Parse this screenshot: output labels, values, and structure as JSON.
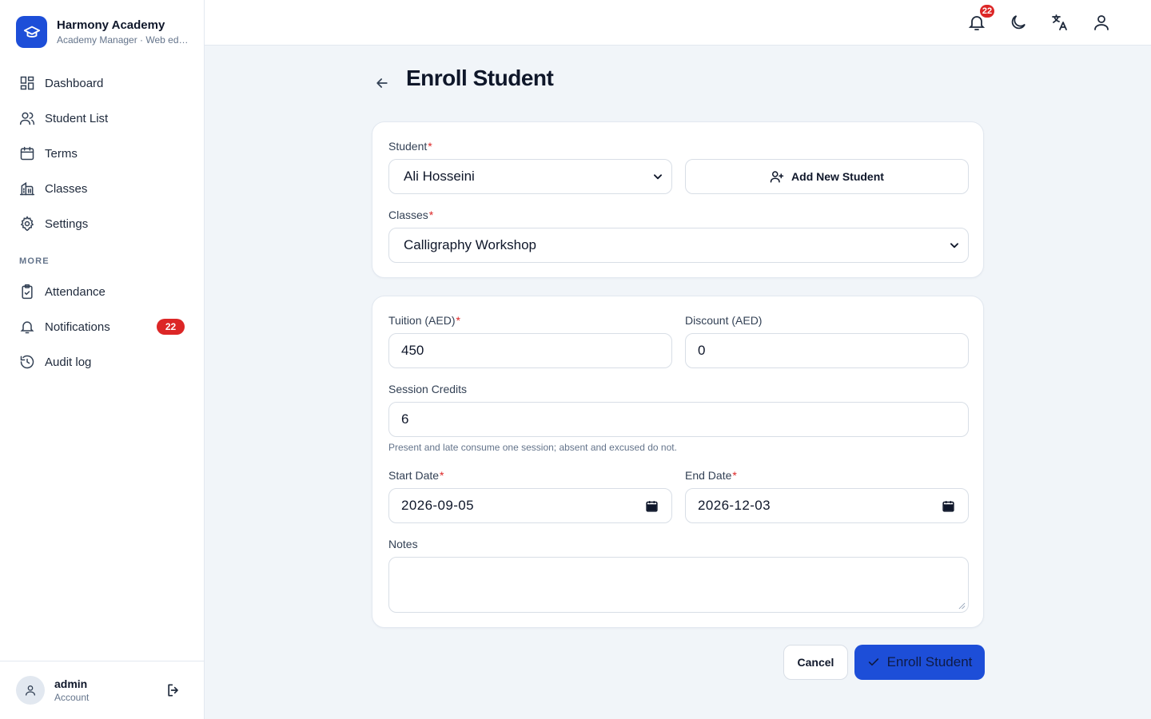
{
  "brand": {
    "name": "Harmony Academy",
    "subtitle": "Academy Manager · Web edition"
  },
  "sidebar": {
    "items": [
      {
        "label": "Dashboard",
        "icon": "dashboard-icon"
      },
      {
        "label": "Student List",
        "icon": "users-icon"
      },
      {
        "label": "Terms",
        "icon": "calendar-icon"
      },
      {
        "label": "Classes",
        "icon": "building-icon"
      },
      {
        "label": "Settings",
        "icon": "gear-icon"
      }
    ],
    "section_label": "MORE",
    "more_items": [
      {
        "label": "Attendance",
        "icon": "clipboard-icon"
      },
      {
        "label": "Notifications",
        "icon": "bell-icon",
        "badge": "22"
      },
      {
        "label": "Audit log",
        "icon": "history-icon"
      }
    ]
  },
  "account": {
    "name": "admin",
    "role": "Account"
  },
  "topbar": {
    "notification_count": "22",
    "icons": [
      "bell-icon",
      "moon-icon",
      "translate-icon",
      "user-icon"
    ]
  },
  "page": {
    "title": "Enroll Student"
  },
  "form": {
    "student_label": "Student",
    "student_value": "Ali Hosseini",
    "add_student_label": "Add New Student",
    "classes_label": "Classes",
    "classes_value": "Calligraphy Workshop",
    "tuition_label": "Tuition (AED)",
    "tuition_value": "450",
    "discount_label": "Discount (AED)",
    "discount_value": "0",
    "credits_label": "Session Credits",
    "credits_value": "6",
    "credits_hint": "Present and late consume one session; absent and excused do not.",
    "start_label": "Start Date",
    "start_value": "2026-09-05",
    "end_label": "End Date",
    "end_value": "2026-12-03",
    "notes_label": "Notes",
    "notes_value": "",
    "required_mark": "*"
  },
  "actions": {
    "cancel": "Cancel",
    "submit": "Enroll Student"
  },
  "colors": {
    "primary": "#1d4ed8",
    "danger": "#dc2626",
    "background": "#f1f5f9"
  }
}
